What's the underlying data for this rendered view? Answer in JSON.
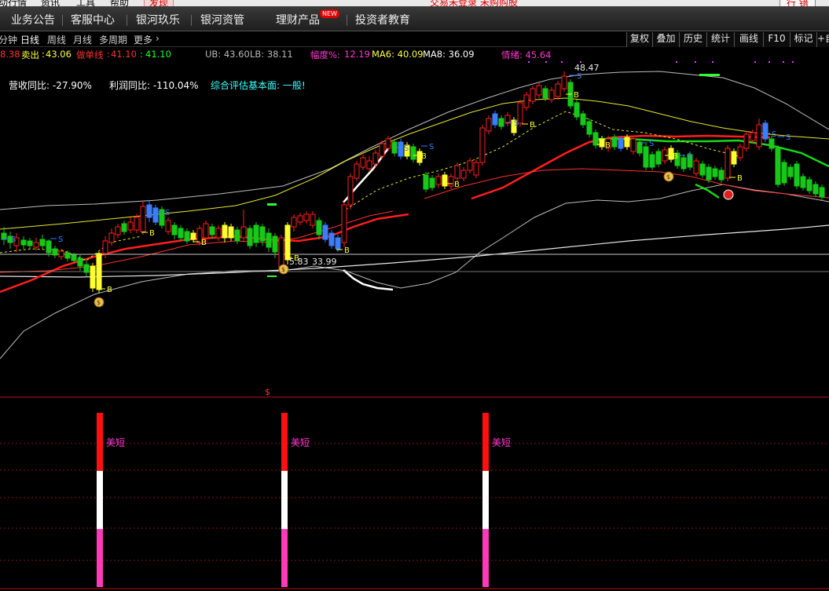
{
  "top_menu": {
    "items": [
      "动行情",
      "资讯",
      "工具",
      "帮助",
      "发现"
    ],
    "login": "交易未登录 未购购股",
    "right_button": "行 错"
  },
  "nav": {
    "items": [
      "业务公告",
      "客服中心",
      "银河玖乐",
      "银河资管",
      "理财产品",
      "投资者教育"
    ],
    "new_badge": "NEW"
  },
  "tabs": {
    "left": [
      "分钟",
      "日线",
      "周线",
      "月线",
      "多周期",
      "更多"
    ],
    "right": [
      "复权",
      "叠加",
      "历史",
      "统计",
      "画线",
      "F10",
      "标记",
      "+自"
    ]
  },
  "indicators": {
    "sell_prev": "8.38",
    "sell_label": "卖出",
    "sell_value": "43.06",
    "short_label": "做单线",
    "short_value": "41.10",
    "short_value2": "41.10",
    "ub": "UB: 43.60",
    "lb": "LB: 38.11",
    "amplitude_label": "幅度%:",
    "amplitude_value": "12.19",
    "ma6": "MA6: 40.09",
    "ma8": "MA8: 36.09",
    "mood": "情绪: 45.64"
  },
  "fundamentals": {
    "revenue": "营收同比: -27.90%",
    "profit": "利润同比: -110.04%",
    "rating": "综合评估基本面: 一般!"
  },
  "chart": {
    "high_label": "48.47",
    "low_label": "33.99",
    "low_label_prefix": "5.83",
    "buy_marker": "B",
    "sell_marker": "S",
    "signal_label": "美短",
    "dollar_marker": "$",
    "colors": {
      "up": "#ff2020",
      "down": "#18c818",
      "ma_red": "#ff1e1e",
      "ma_yellow": "#e8e830",
      "band": "#bdbdbd",
      "white": "#ffffff",
      "buy": "#ffff30",
      "sell": "#3a7dff",
      "signal_pink": "#ff39b8"
    }
  }
}
